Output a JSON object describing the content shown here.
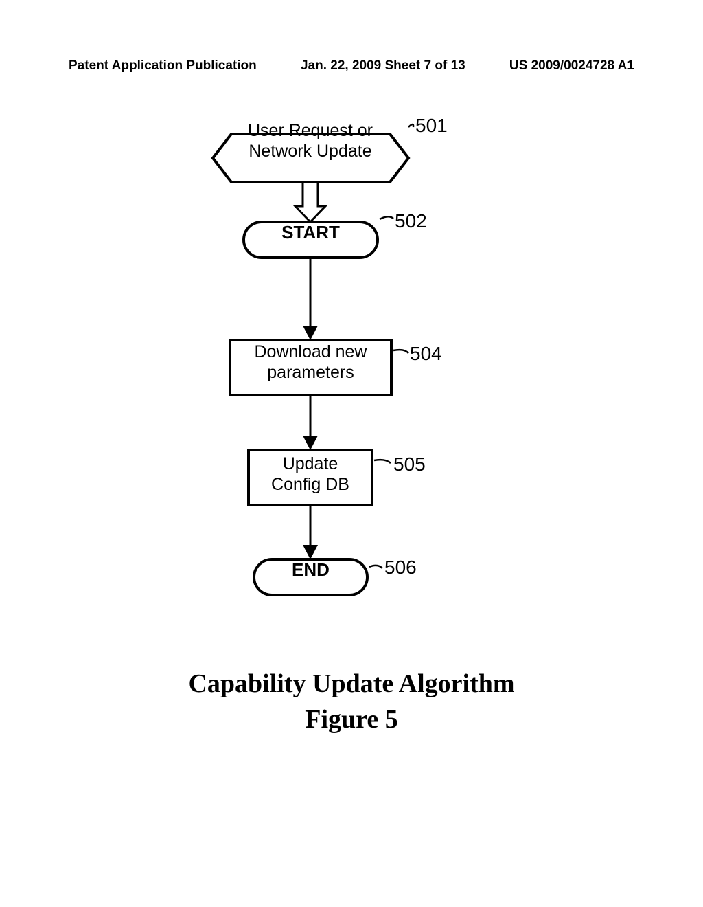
{
  "header": {
    "left": "Patent Application Publication",
    "center": "Jan. 22, 2009  Sheet 7 of 13",
    "right": "US 2009/0024728 A1"
  },
  "nodes": {
    "hexagon": {
      "line1": "User Request or",
      "line2": "Network Update"
    },
    "start": "START",
    "download": {
      "line1": "Download new",
      "line2": "parameters"
    },
    "update": {
      "line1": "Update",
      "line2": "Config DB"
    },
    "end": "END"
  },
  "labels": {
    "n501": "501",
    "n502": "502",
    "n504": "504",
    "n505": "505",
    "n506": "506"
  },
  "title": "Capability Update Algorithm",
  "subtitle": "Figure 5"
}
